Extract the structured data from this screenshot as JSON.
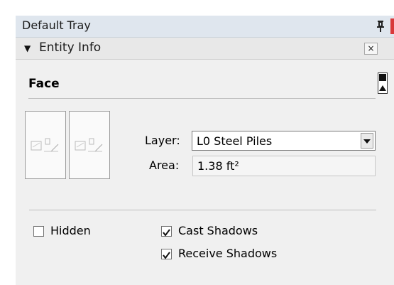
{
  "tray": {
    "title": "Default Tray"
  },
  "panel": {
    "title": "Entity Info",
    "close_label": "×"
  },
  "entity": {
    "type": "Face"
  },
  "layer": {
    "label": "Layer:",
    "value": "L0 Steel Piles"
  },
  "area": {
    "label": "Area:",
    "value": "1.38 ft²"
  },
  "options": {
    "hidden": {
      "label": "Hidden",
      "checked": false
    },
    "cast_shadows": {
      "label": "Cast Shadows",
      "checked": true
    },
    "receive_shadows": {
      "label": "Receive Shadows",
      "checked": true
    }
  },
  "colors": {
    "accent_red": "#d9383a",
    "title_bar": "#dfe6ee"
  }
}
